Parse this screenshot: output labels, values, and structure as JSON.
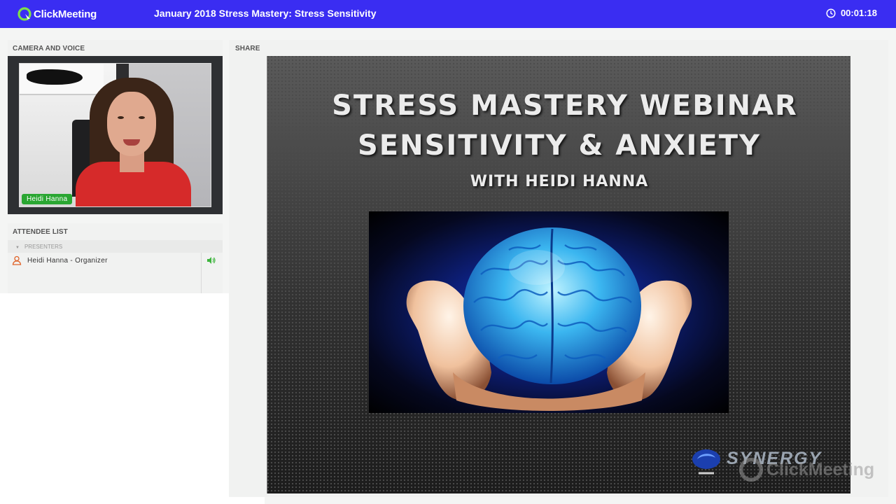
{
  "app": {
    "logo_text": "ClickMeeting",
    "meeting_title": "January 2018 Stress Mastery: Stress Sensitivity",
    "timer": "00:01:18",
    "accent_color": "#3a2df2"
  },
  "camera_panel": {
    "header": "CAMERA AND VOICE",
    "presenter_name": "Heidi Hanna"
  },
  "attendee_panel": {
    "header": "ATTENDEE LIST",
    "group_label": "PRESENTERS",
    "attendees": [
      {
        "name": "Heidi Hanna - Organizer",
        "icon": "person-icon",
        "audio_icon": "speaker-icon"
      }
    ]
  },
  "share_panel": {
    "header": "SHARE",
    "slide": {
      "title_line1": "STRESS MASTERY WEBINAR",
      "title_line2": "SENSITIVITY & ANXIETY",
      "subtitle": "WITH HEIDI HANNA",
      "image": "brain-in-hands",
      "logo_text": "SYNERGY"
    },
    "watermark": "ClickMeeting"
  }
}
